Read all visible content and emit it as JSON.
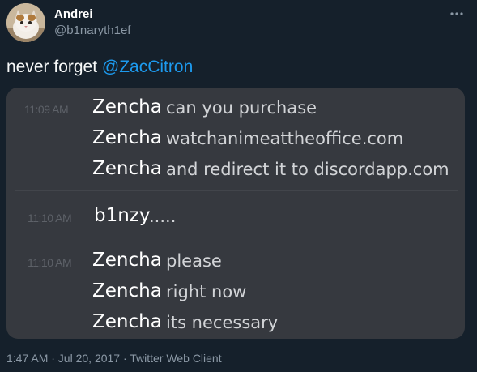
{
  "tweet": {
    "display_name": "Andrei",
    "handle": "@b1naryth1ef",
    "text_prefix": "never forget ",
    "mention": "@ZacCitron",
    "footer": "1:47 AM · Jul 20, 2017 · Twitter Web Client",
    "more_icon": "ellipsis-icon"
  },
  "chat": {
    "groups": [
      {
        "lines": [
          {
            "time": "11:09 AM",
            "author": "Zencha",
            "text": "can you purchase"
          },
          {
            "time": "",
            "author": "Zencha",
            "text": "watchanimeattheoffice.com"
          },
          {
            "time": "",
            "author": "Zencha",
            "text": "and redirect it to discordapp.com"
          }
        ]
      },
      {
        "lines": [
          {
            "time": "11:10 AM",
            "author": "b1nzy",
            "text": "....."
          }
        ]
      },
      {
        "lines": [
          {
            "time": "11:10 AM",
            "author": "Zencha",
            "text": "please"
          },
          {
            "time": "",
            "author": "Zencha",
            "text": "right now"
          },
          {
            "time": "",
            "author": "Zencha",
            "text": "its necessary"
          }
        ]
      }
    ]
  },
  "colors": {
    "background": "#15202b",
    "link": "#1d9bf0",
    "secondary_text": "#8b98a5",
    "chat_background": "#36393f"
  }
}
